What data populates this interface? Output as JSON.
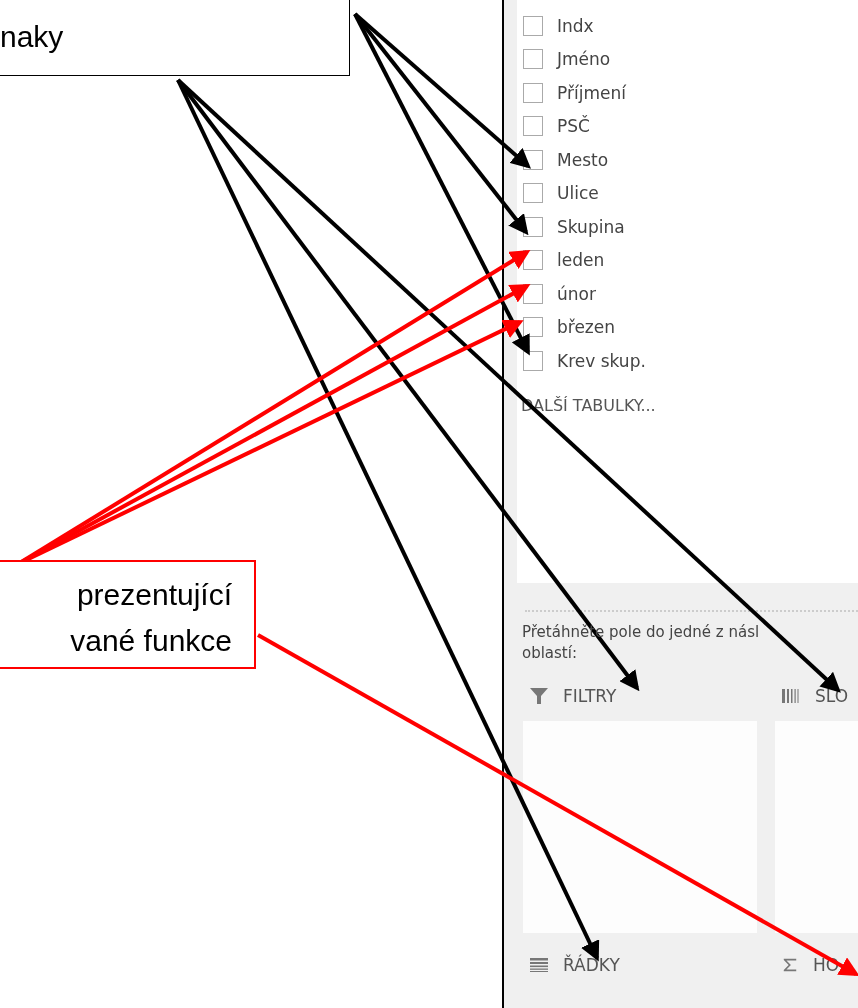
{
  "callouts": [
    {
      "lines": [
        "naky"
      ],
      "color": "#000000"
    },
    {
      "lines": [
        "prezentující",
        "vané funkce"
      ],
      "color": "#ff0000"
    }
  ],
  "field_list": {
    "fields": [
      {
        "label": "Indx",
        "checked": false
      },
      {
        "label": "Jméno",
        "checked": false
      },
      {
        "label": "Příjmení",
        "checked": false
      },
      {
        "label": "PSČ",
        "checked": false
      },
      {
        "label": "Mesto",
        "checked": false
      },
      {
        "label": "Ulice",
        "checked": false
      },
      {
        "label": "Skupina",
        "checked": false
      },
      {
        "label": "leden",
        "checked": false
      },
      {
        "label": "únor",
        "checked": false
      },
      {
        "label": "březen",
        "checked": false
      },
      {
        "label": "Krev skup.",
        "checked": false
      }
    ],
    "more_tables": "DALŠÍ TABULKY..."
  },
  "instruction_lines": [
    "Přetáhněte pole do jedné z násl",
    "oblastí:"
  ],
  "areas": [
    {
      "kind": "filters",
      "label": "FILTRY"
    },
    {
      "kind": "columns",
      "label": "SLO"
    },
    {
      "kind": "rows",
      "label": "ŘÁDKY"
    },
    {
      "kind": "values",
      "label": "HO"
    }
  ]
}
